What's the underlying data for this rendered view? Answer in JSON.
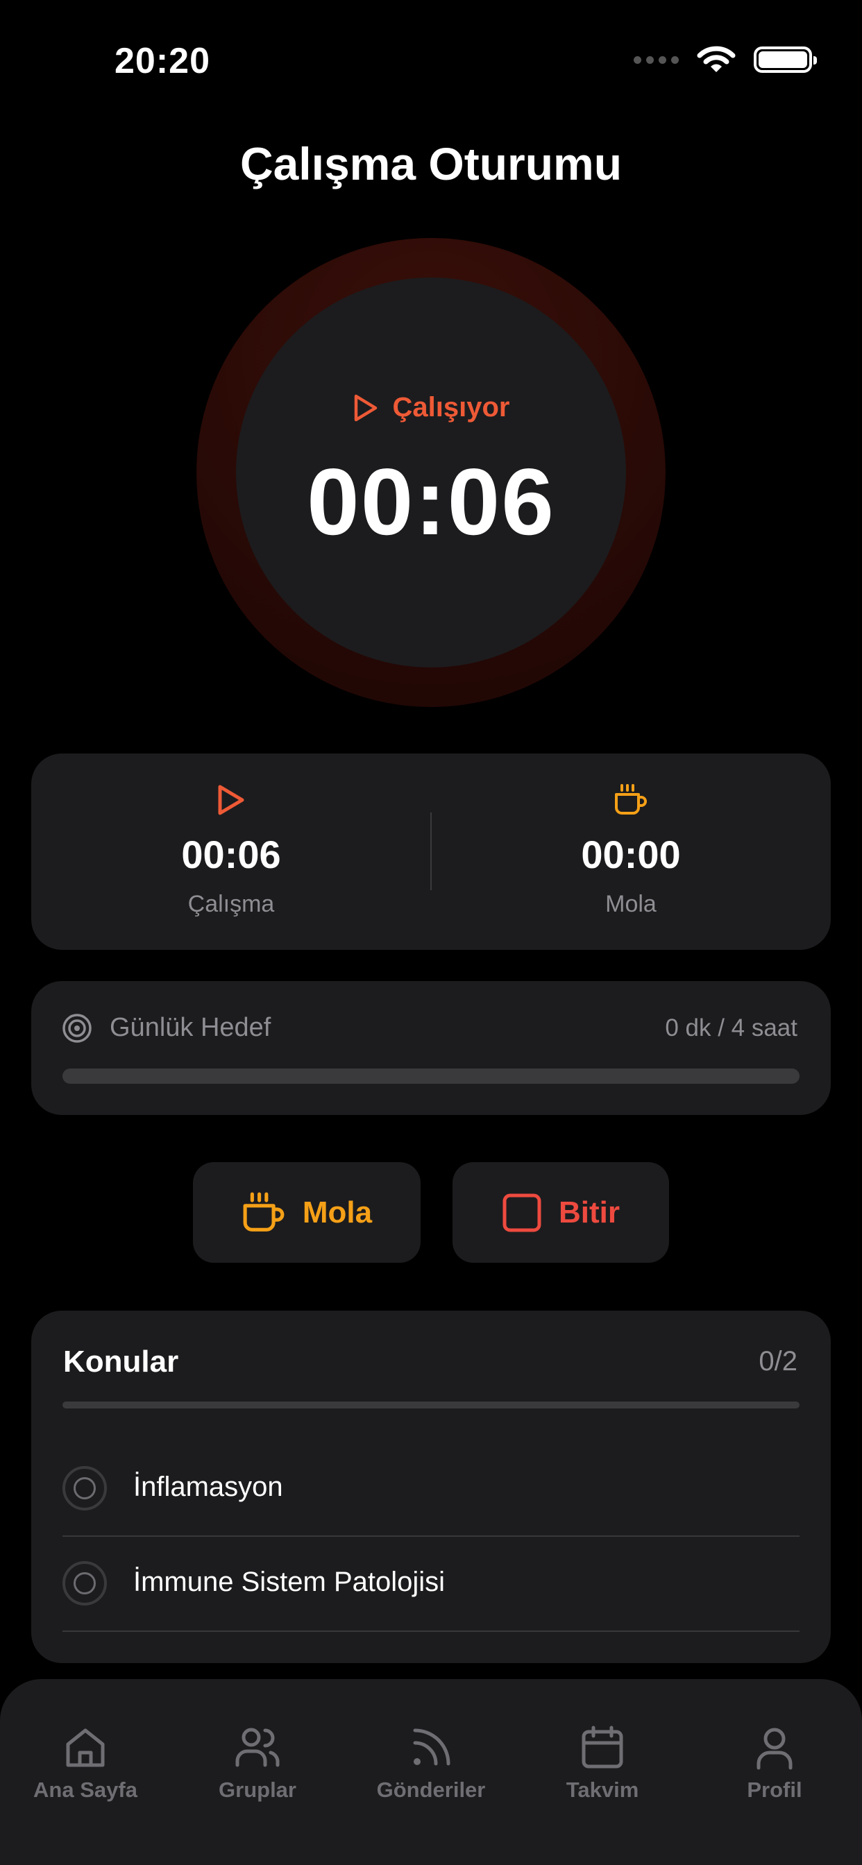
{
  "status_bar": {
    "time": "20:20",
    "icons": [
      "signal-icon",
      "wifi-icon",
      "battery-icon"
    ]
  },
  "page": {
    "title": "Çalışma Oturumu"
  },
  "timer": {
    "state_label": "Çalışıyor",
    "value": "00:06",
    "state_icon": "play-icon"
  },
  "stats": {
    "work": {
      "value": "00:06",
      "label": "Çalışma",
      "icon": "play-icon"
    },
    "break": {
      "value": "00:00",
      "label": "Mola",
      "icon": "coffee-cup-icon"
    }
  },
  "daily_goal": {
    "title": "Günlük Hedef",
    "progress_text": "0 dk / 4 saat",
    "progress_fraction": 0,
    "icon": "target-icon"
  },
  "actions": {
    "break_label": "Mola",
    "finish_label": "Bitir"
  },
  "topics": {
    "title": "Konular",
    "count": "0/2",
    "progress_fraction": 0,
    "items": [
      {
        "name": "İnflamasyon",
        "completed": false
      },
      {
        "name": "İmmune Sistem Patolojisi",
        "completed": false
      }
    ]
  },
  "tab_bar": {
    "items": [
      {
        "label": "Ana Sayfa",
        "icon": "home-icon"
      },
      {
        "label": "Gruplar",
        "icon": "users-icon"
      },
      {
        "label": "Gönderiler",
        "icon": "rss-feed-icon"
      },
      {
        "label": "Takvim",
        "icon": "calendar-icon"
      },
      {
        "label": "Profil",
        "icon": "user-icon"
      }
    ]
  },
  "colors": {
    "accent_work": "#ee5a36",
    "accent_break": "#f5a017",
    "accent_finish": "#ee4a3f",
    "card": "#1c1c1e",
    "muted_text": "#8e8e93"
  }
}
